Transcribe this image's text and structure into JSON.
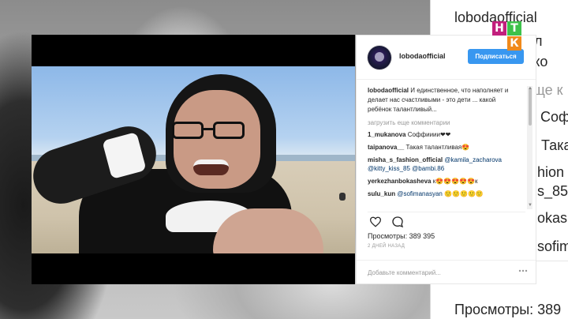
{
  "post": {
    "username": "lobodaofficial",
    "follow_label": "Подписаться",
    "caption_user": "lobodaofficial",
    "caption_text": "И единственное, что наполняет и делает нас счастливыми - это дети ... какой ребёнок талантливый...",
    "load_more": "загрузить еще комментарии",
    "comments": [
      {
        "user": "1_mukanova",
        "text": "Соффииии❤❤"
      },
      {
        "user": "taipanova__",
        "text": "Такая талантливая😍"
      },
      {
        "user": "misha_s_fashion_official",
        "text": "@kamila_zacharova @kitty_kiss_85 @bambi.86"
      },
      {
        "user": "yerkezhanbokasheva",
        "text": "к😍😍😍😍😍к"
      },
      {
        "user": "sulu_kun",
        "text": "@sofimanasyan 🙂🙂🙂🙂🙂"
      }
    ],
    "views": "Просмотры: 389 395",
    "date": "2 ДНЕЙ НАЗАД",
    "add_comment_placeholder": "Добавьте комментарий..."
  },
  "logo": {
    "l1": "Н",
    "l2": "Т",
    "l3": "К"
  },
  "background": {
    "lines": [
      "lobodaofficial",
      "и дел",
      "како",
      "ще к",
      "а Соф",
      "Така",
      "hion",
      "s_85",
      "okas",
      "sofim",
      "Просмотры: 389"
    ]
  },
  "colors": {
    "accent": "#3897f0",
    "logo_magenta": "#c21f7d",
    "logo_green": "#3dc24b",
    "logo_orange": "#f08a1c"
  }
}
